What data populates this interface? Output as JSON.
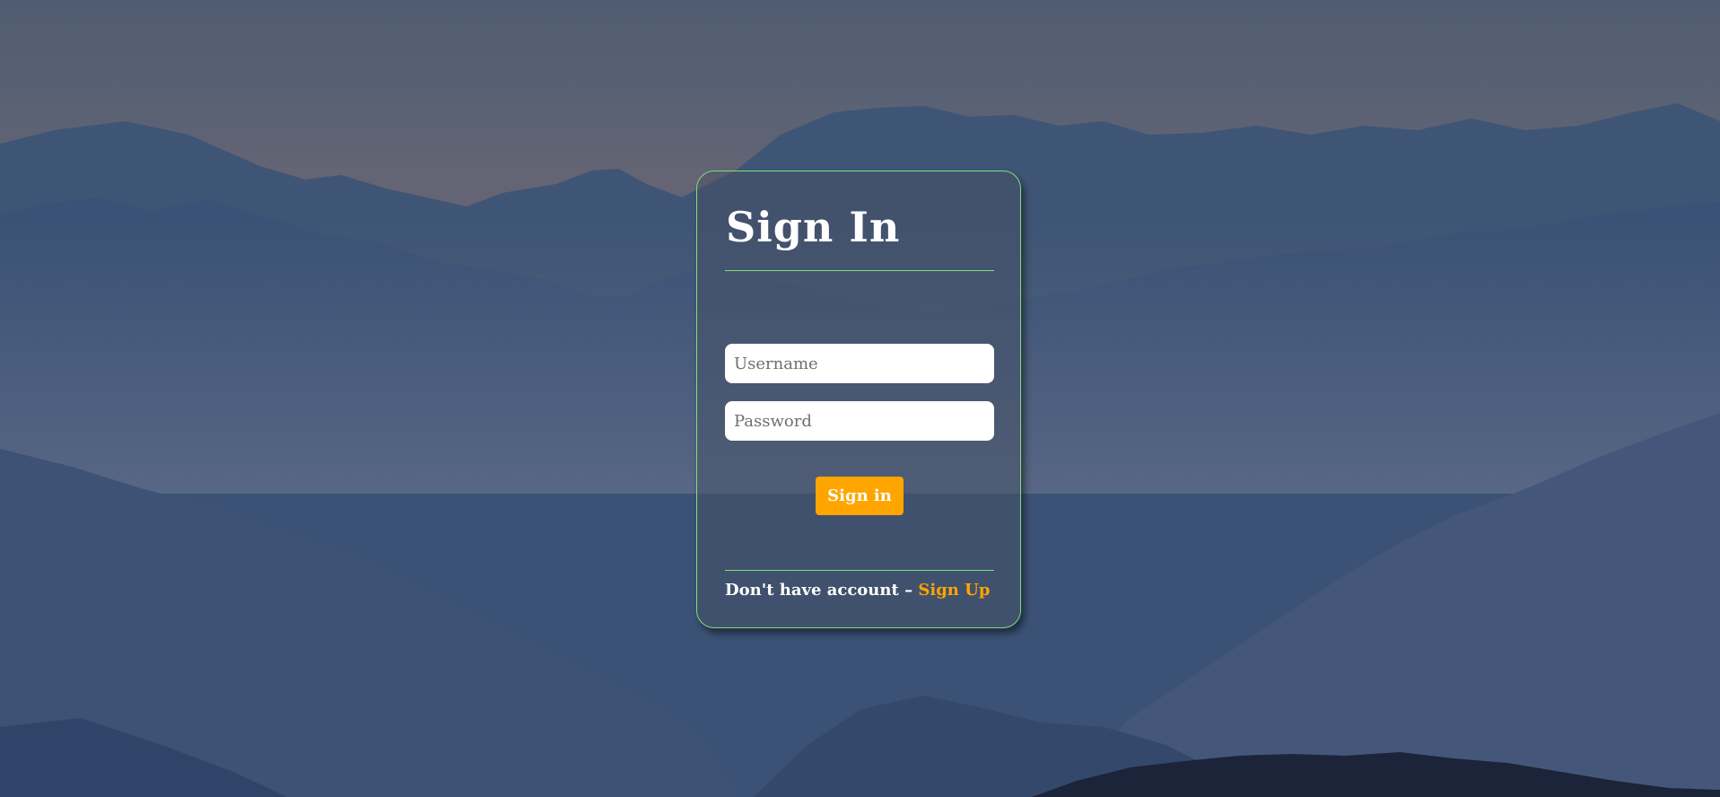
{
  "background": {
    "description_icon": "mountain-landscape-icon"
  },
  "login": {
    "title": "Sign In",
    "username_placeholder": "Username",
    "username_value": "",
    "password_placeholder": "Password",
    "password_value": "",
    "submit_label": "Sign in",
    "footer_text": "Don't have account –",
    "signup_link": "Sign Up"
  },
  "colors": {
    "accent": "#ffa500",
    "border": "#7ee07a",
    "text": "#ffffff"
  }
}
